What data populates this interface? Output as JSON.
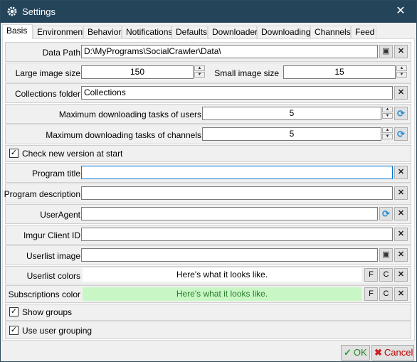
{
  "window": {
    "title": "Settings",
    "close": "✕"
  },
  "tabs": [
    "Basis",
    "Environment",
    "Behavior",
    "Notifications",
    "Defaults",
    "Downloader",
    "Downloading",
    "Channels",
    "Feed"
  ],
  "basis": {
    "data_path": {
      "label": "Data Path",
      "value": "D:\\MyPrograms\\SocialCrawler\\Data\\"
    },
    "large_image_size": {
      "label": "Large image size",
      "value": "150"
    },
    "small_image_size": {
      "label": "Small image size",
      "value": "15"
    },
    "collections_folder": {
      "label": "Collections folder",
      "value": "Collections"
    },
    "max_tasks_users": {
      "label": "Maximum downloading tasks of users",
      "value": "5"
    },
    "max_tasks_channels": {
      "label": "Maximum downloading tasks of channels",
      "value": "5"
    },
    "check_new_version": {
      "label": "Check new version at start",
      "checked": true
    },
    "program_title": {
      "label": "Program title",
      "value": ""
    },
    "program_description": {
      "label": "Program description",
      "value": ""
    },
    "user_agent": {
      "label": "UserAgent",
      "value": ""
    },
    "imgur_client_id": {
      "label": "Imgur Client ID",
      "value": ""
    },
    "userlist_image": {
      "label": "Userlist image",
      "value": ""
    },
    "userlist_colors": {
      "label": "Userlist colors",
      "sample": "Here's what it looks like.",
      "bg": "#ffffff",
      "fore": "#000000"
    },
    "subscriptions_color": {
      "label": "Subscriptions color",
      "sample": "Here's what it looks like.",
      "bg": "#c8f7c5",
      "fore": "#2a7a2a"
    },
    "show_groups": {
      "label": "Show groups",
      "checked": true
    },
    "use_user_grouping": {
      "label": "Use user grouping",
      "checked": true
    },
    "color_btn_f": "F",
    "color_btn_c": "C"
  },
  "footer": {
    "ok": "OK",
    "cancel": "Cancel"
  },
  "icons": {
    "clear": "✕",
    "refresh": "⟳",
    "check": "✓",
    "folder": "▣"
  }
}
